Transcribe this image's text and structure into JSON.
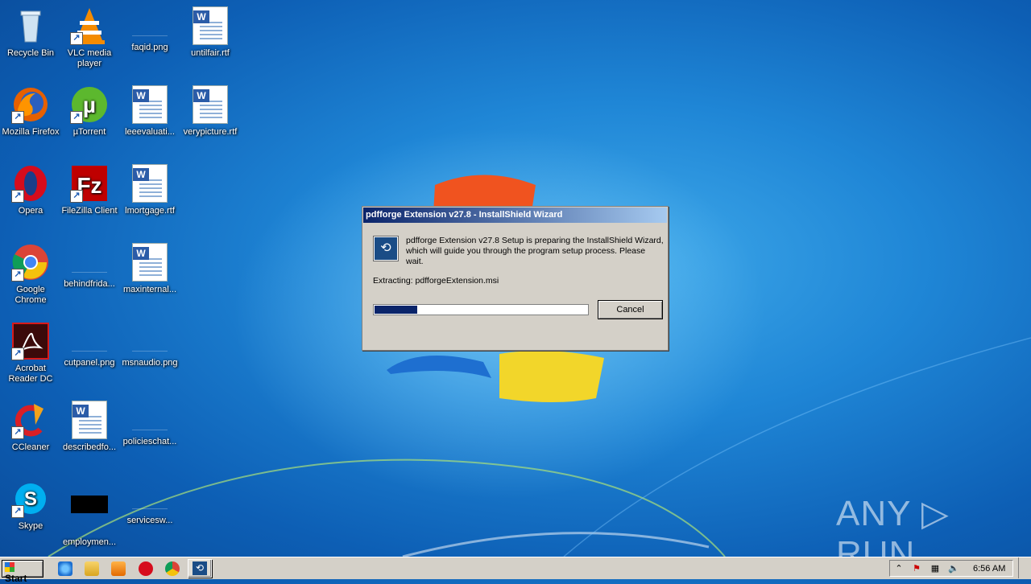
{
  "desktop": {
    "icons": [
      {
        "label": "Recycle Bin"
      },
      {
        "label": "VLC media player"
      },
      {
        "label": "faqid.png"
      },
      {
        "label": "untilfair.rtf"
      },
      {
        "label": "Mozilla Firefox"
      },
      {
        "label": "µTorrent"
      },
      {
        "label": "leeevaluati..."
      },
      {
        "label": "verypicture.rtf"
      },
      {
        "label": "Opera"
      },
      {
        "label": "FileZilla Client"
      },
      {
        "label": "lmortgage.rtf"
      },
      {
        "label": "Google Chrome"
      },
      {
        "label": "behindfrida..."
      },
      {
        "label": "maxinternal..."
      },
      {
        "label": "Acrobat Reader DC"
      },
      {
        "label": "cutpanel.png"
      },
      {
        "label": "msnaudio.png"
      },
      {
        "label": "CCleaner"
      },
      {
        "label": "describedfo..."
      },
      {
        "label": "policieschat..."
      },
      {
        "label": "Skype"
      },
      {
        "label": "employmen..."
      },
      {
        "label": "servicesw..."
      }
    ]
  },
  "dialog": {
    "title": "pdfforge Extension v27.8 - InstallShield Wizard",
    "message": "pdfforge Extension v27.8 Setup is preparing the InstallShield Wizard, which will guide you through the program setup process. Please wait.",
    "status": "Extracting: pdfforgeExtension.msi",
    "progress_fraction": 0.2,
    "cancel_label": "Cancel"
  },
  "taskbar": {
    "start_label": "Start",
    "pinned": [
      "ie-icon",
      "explorer-icon",
      "media-player-icon",
      "opera-icon",
      "chrome-icon",
      "installer-icon"
    ],
    "clock": "6:56 AM"
  },
  "watermark": "ANY ▷ RUN",
  "colors": {
    "titlebar": "#0a246a",
    "dialog_bg": "#d4d0c8",
    "desktop": "#1f86d6"
  }
}
